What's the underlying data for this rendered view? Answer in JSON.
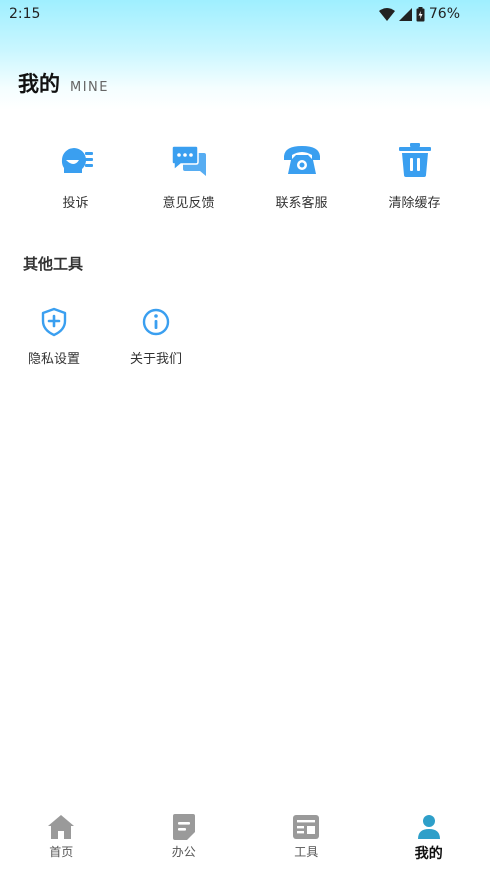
{
  "status_bar": {
    "time": "2:15",
    "battery": "76%"
  },
  "header": {
    "title": "我的",
    "subtitle": "MINE"
  },
  "services": [
    {
      "label": "投诉",
      "icon": "complaint-icon"
    },
    {
      "label": "意见反馈",
      "icon": "feedback-chat-icon"
    },
    {
      "label": "联系客服",
      "icon": "telephone-icon"
    },
    {
      "label": "清除缓存",
      "icon": "trash-icon"
    }
  ],
  "other_tools": {
    "title": "其他工具",
    "items": [
      {
        "label": "隐私设置",
        "icon": "shield-plus-icon"
      },
      {
        "label": "关于我们",
        "icon": "info-icon"
      }
    ]
  },
  "bottom_nav": [
    {
      "label": "首页",
      "icon": "home-icon",
      "active": false
    },
    {
      "label": "办公",
      "icon": "document-icon",
      "active": false
    },
    {
      "label": "工具",
      "icon": "toolbox-icon",
      "active": false
    },
    {
      "label": "我的",
      "icon": "person-icon",
      "active": true
    }
  ],
  "colors": {
    "accent": "#3a9ff0",
    "nav_active": "#2e9fc9",
    "nav_inactive": "#9a9a9a",
    "header_gradient_top": "#9fefff"
  }
}
